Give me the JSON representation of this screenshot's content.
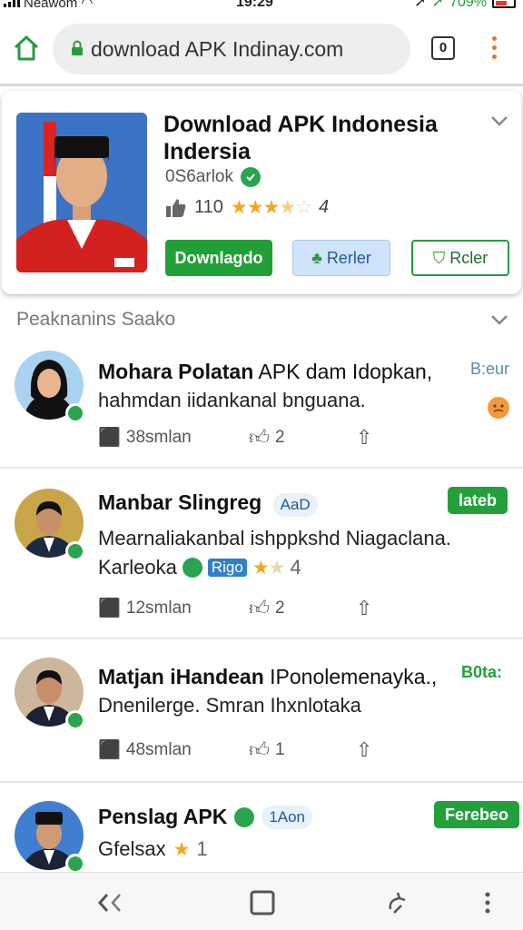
{
  "status_bar": {
    "carrier": "Neawom",
    "time": "19:29",
    "battery": "709%"
  },
  "browser": {
    "url": "download APK Indinay.com",
    "tabs_count": "0"
  },
  "app": {
    "title": "Download APK Indonesia",
    "subtitle": "Indersia",
    "developer": "0S6arlok",
    "likes": "110",
    "rating_stars": 3.5,
    "rating_value": "4",
    "download_label": "Downlagdo",
    "review_label": "Rerler",
    "report_label": "Rcler"
  },
  "section": {
    "title": "Peaknanins Saako"
  },
  "reviews": [
    {
      "name": "Mohara Polatan",
      "name_rest": "APK dam Idopkan,",
      "line2": "hahmdan iidankanal bnguana.",
      "tag": "B:eur",
      "time": "38smlan",
      "likes": "2"
    },
    {
      "name": "Manbar Slingreg",
      "badge": "AaD",
      "line2": "Mearnaliakanbal ishppkshd Niagaclana.",
      "line3_a": "Karleoka",
      "line3_badge": "Rigo",
      "line3_val": "4",
      "tag": "lateb",
      "time": "12smlan",
      "likes": "2"
    },
    {
      "name": "Matjan iHandean",
      "name_rest": "IPonolemenayka.,",
      "line2": "Dnenilerge. Smran Ihxnlotaka",
      "tag": "B0ta:",
      "time": "48smlan",
      "likes": "1"
    },
    {
      "name": "Penslag APK",
      "badge": "1Aon",
      "line2_a": "Gfelsax",
      "line2_val": "1",
      "tag": "Ferebeo"
    }
  ],
  "colors": {
    "accent_green": "#23a03b",
    "star": "#f2a81d",
    "link_blue": "#245a9e"
  }
}
